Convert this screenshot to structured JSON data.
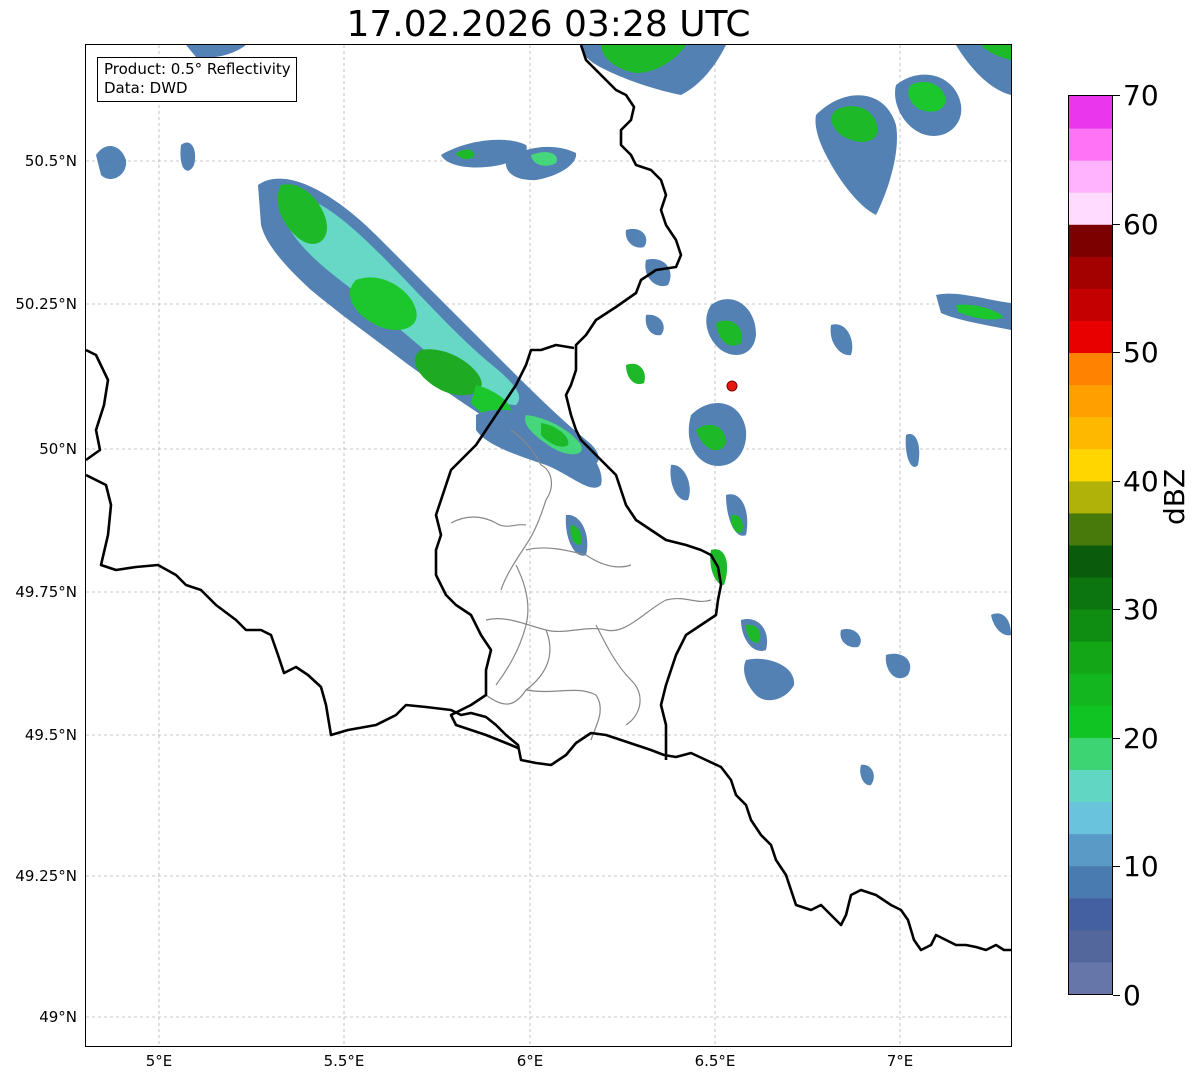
{
  "title": "17.02.2026 03:28 UTC",
  "infobox": {
    "product": "Product: 0.5° Reflectivity",
    "data": "Data: DWD"
  },
  "map": {
    "latitude_labels": [
      "50.5°N",
      "50.25°N",
      "50°N",
      "49.75°N",
      "49.5°N",
      "49.25°N",
      "49°N"
    ],
    "longitude_labels": [
      "5°E",
      "5.5°E",
      "6°E",
      "6.5°E",
      "7°E"
    ],
    "extent": {
      "lon": [
        4.8,
        7.3
      ],
      "lat": [
        48.95,
        50.7
      ]
    },
    "gridlines": true,
    "radar_site_marker": {
      "lon": 6.55,
      "lat": 50.11,
      "color": "#e8170f"
    }
  },
  "colorbar": {
    "label": "dBZ",
    "ticks": [
      "0",
      "10",
      "20",
      "30",
      "40",
      "50",
      "60",
      "70"
    ],
    "range": [
      0,
      70
    ],
    "step": 2.5,
    "colors": [
      "#6676a8",
      "#53679c",
      "#4460a1",
      "#4a7bb0",
      "#5a9ac6",
      "#69c3dc",
      "#60d6c3",
      "#3dd474",
      "#10c523",
      "#13b61e",
      "#13a617",
      "#0f8d12",
      "#0c7510",
      "#0b5b0c",
      "#477a0a",
      "#b0b20a",
      "#ffd600",
      "#ffb800",
      "#ff9f00",
      "#ff8300",
      "#e80000",
      "#c40000",
      "#a30000",
      "#7c0000",
      "#ffdcff",
      "#ffb3ff",
      "#ff74f6",
      "#ea36ec"
    ]
  }
}
